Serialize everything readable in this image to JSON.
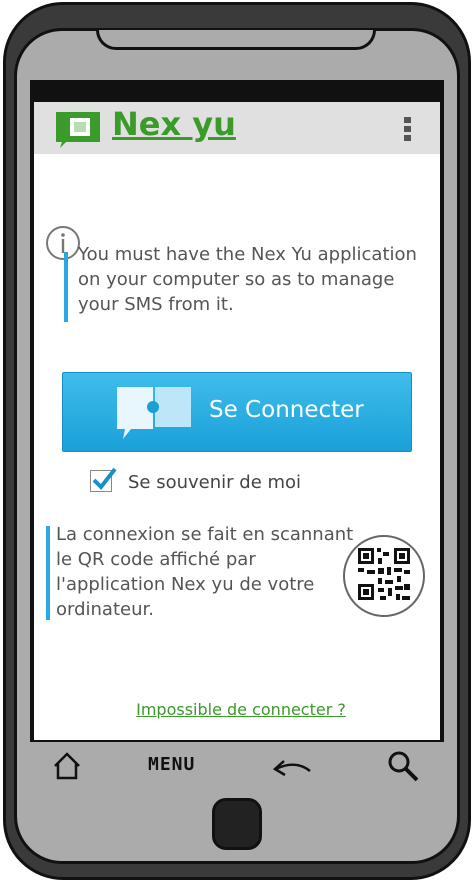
{
  "app": {
    "title": "Nex yu"
  },
  "info": {
    "text": "You must have the Nex Yu application on your computer so as to manage your SMS from it."
  },
  "connect_button": {
    "label": "Se Connecter"
  },
  "remember_me": {
    "label": "Se souvenir de moi",
    "checked": true
  },
  "qr_info": {
    "text": "La connexion se fait en scannant le QR code affiché par l'application Nex yu de votre ordinateur."
  },
  "help_link": {
    "label": "Impossible de connecter ?"
  },
  "nav": {
    "menu_label": "MENU"
  },
  "colors": {
    "accent_green": "#3a9a2a",
    "accent_blue": "#2aa9e0"
  }
}
